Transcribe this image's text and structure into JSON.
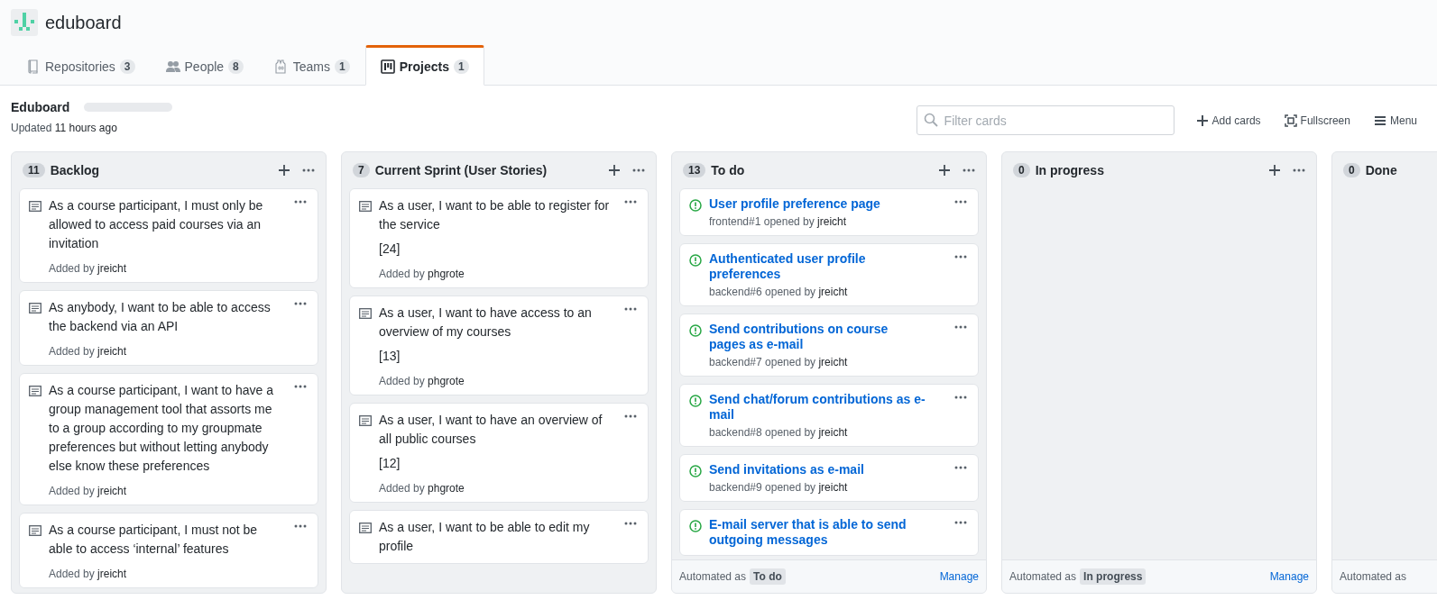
{
  "org": {
    "name": "eduboard"
  },
  "tabs": [
    {
      "label": "Repositories",
      "count": "3",
      "selected": false
    },
    {
      "label": "People",
      "count": "8",
      "selected": false
    },
    {
      "label": "Teams",
      "count": "1",
      "selected": false
    },
    {
      "label": "Projects",
      "count": "1",
      "selected": true
    }
  ],
  "project": {
    "title": "Eduboard",
    "updated_label": "Updated",
    "updated_time": "11 hours ago"
  },
  "filter": {
    "placeholder": "Filter cards"
  },
  "actions": [
    {
      "label": "Add cards"
    },
    {
      "label": "Fullscreen"
    },
    {
      "label": "Menu"
    }
  ],
  "columns": [
    {
      "title": "Backlog",
      "count": "11",
      "cards": [
        {
          "kind": "note",
          "text": "As a course participant, I must only be allowed to access paid courses via an invitation",
          "added_label": "Added by",
          "user": "jreicht"
        },
        {
          "kind": "note",
          "text": "As anybody, I want to be able to access the backend via an API",
          "added_label": "Added by",
          "user": "jreicht"
        },
        {
          "kind": "note",
          "text": "As a course participant, I want to have a group management tool that assorts me to a group according to my groupmate preferences but without letting anybody else know these preferences",
          "added_label": "Added by",
          "user": "jreicht"
        },
        {
          "kind": "note",
          "text": "As a course participant, I must not be able to access ‘internal’ features",
          "added_label": "Added by",
          "user": "jreicht"
        }
      ]
    },
    {
      "title": "Current Sprint (User Stories)",
      "count": "7",
      "cards": [
        {
          "kind": "note",
          "text": "As a user, I want to be able to register for the service",
          "estimate": "[24]",
          "added_label": "Added by",
          "user": "phgrote"
        },
        {
          "kind": "note",
          "text": "As a user, I want to have access to an overview of my courses",
          "estimate": "[13]",
          "added_label": "Added by",
          "user": "phgrote"
        },
        {
          "kind": "note",
          "text": "As a user, I want to have an overview of all public courses",
          "estimate": "[12]",
          "added_label": "Added by",
          "user": "phgrote"
        },
        {
          "kind": "note",
          "text": "As a user, I want to be able to edit my profile"
        }
      ]
    },
    {
      "title": "To do",
      "count": "13",
      "automated_label": "Automated as",
      "automated_state": "To do",
      "manage": "Manage",
      "cards": [
        {
          "kind": "issue",
          "text": "User profile preference page",
          "ref": "frontend#1",
          "opened_label": "opened by",
          "user": "jreicht"
        },
        {
          "kind": "issue",
          "text": "Authenticated user profile preferences",
          "ref": "backend#6",
          "opened_label": "opened by",
          "user": "jreicht"
        },
        {
          "kind": "issue",
          "text": "Send contributions on course pages as e-mail",
          "ref": "backend#7",
          "opened_label": "opened by",
          "user": "jreicht"
        },
        {
          "kind": "issue",
          "text": "Send chat/forum contributions as e-mail",
          "ref": "backend#8",
          "opened_label": "opened by",
          "user": "jreicht"
        },
        {
          "kind": "issue",
          "text": "Send invitations as e-mail",
          "ref": "backend#9",
          "opened_label": "opened by",
          "user": "jreicht"
        },
        {
          "kind": "issue",
          "text": "E-mail server that is able to send outgoing messages"
        }
      ]
    },
    {
      "title": "In progress",
      "count": "0",
      "automated_label": "Automated as",
      "automated_state": "In progress",
      "manage": "Manage"
    },
    {
      "title": "Done",
      "count": "0",
      "automated_label": "Automated as"
    }
  ]
}
